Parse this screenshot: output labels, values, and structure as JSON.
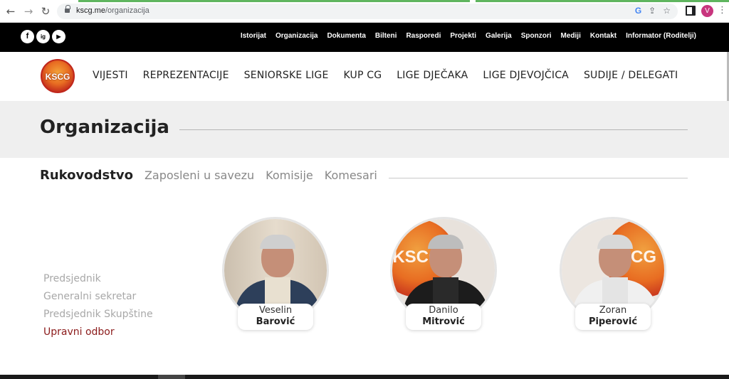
{
  "browser": {
    "url_host": "kscg.me",
    "url_path": "/organizacija",
    "avatar_letter": "V",
    "back_icon": "arrow-left",
    "forward_icon": "arrow-right",
    "reload_icon": "reload",
    "google_icon": "G",
    "share_icon": "share",
    "star_icon": "star",
    "menu_icon": "kebab"
  },
  "social": [
    "f",
    "ig",
    "▶"
  ],
  "top_links": [
    "Istorijat",
    "Organizacija",
    "Dokumenta",
    "Bilteni",
    "Rasporedi",
    "Projekti",
    "Galerija",
    "Sponzori",
    "Mediji",
    "Kontakt",
    "Informator (Roditelji)"
  ],
  "logo_text": "KSCG",
  "main_menu": [
    "VIJESTI",
    "REPREZENTACIJE",
    "SENIORSKE LIGE",
    "KUP CG",
    "LIGE DJEČAKA",
    "LIGE DJEVOJČICA",
    "SUDIJE / DELEGATI"
  ],
  "page_title": "Organizacija",
  "tabs": [
    "Rukovodstvo",
    "Zaposleni u savezu",
    "Komisije",
    "Komesari"
  ],
  "submenu": [
    "Predsjednik",
    "Generalni sekretar",
    "Predsjednik Skupštine",
    "Upravni odbor"
  ],
  "people": [
    {
      "first": "Veselin",
      "last": "Barović",
      "photo_bg": "#d8cdbf",
      "suit": "#2d3f5a"
    },
    {
      "first": "Danilo",
      "last": "Mitrović",
      "photo_bg": "#d9642a",
      "suit": "#1c1c1c"
    },
    {
      "first": "Zoran",
      "last": "Piperović",
      "photo_bg": "#d8a890",
      "suit": "#eeeeee"
    }
  ],
  "colors": {
    "accent": "#8b1a1a",
    "dark": "#000000",
    "band": "#efefef"
  }
}
